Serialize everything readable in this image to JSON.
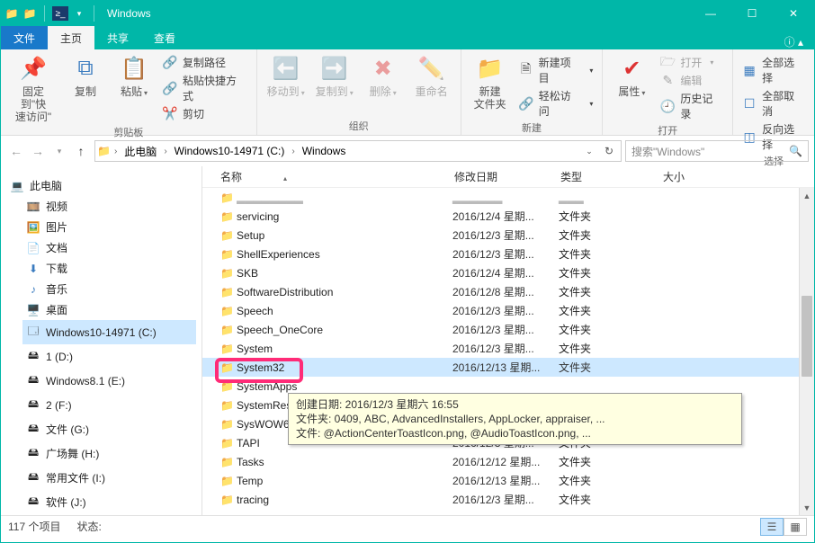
{
  "title": "Windows",
  "tabs": {
    "file": "文件",
    "home": "主页",
    "share": "共享",
    "view": "查看"
  },
  "ribbon": {
    "pin": "固定到\"快\n速访问\"",
    "copy": "复制",
    "paste": "粘贴",
    "copypath": "复制路径",
    "pastelnk": "粘贴快捷方式",
    "cut": "剪切",
    "g1": "剪贴板",
    "moveto": "移动到",
    "copyto": "复制到",
    "delete": "删除",
    "rename": "重命名",
    "g2": "组织",
    "newfolder": "新建\n文件夹",
    "newitem": "新建项目",
    "easyaccess": "轻松访问",
    "g3": "新建",
    "props": "属性",
    "open": "打开",
    "edit": "编辑",
    "history": "历史记录",
    "g4": "打开",
    "selectall": "全部选择",
    "selectnone": "全部取消",
    "invertsel": "反向选择",
    "g5": "选择"
  },
  "breadcrumb": {
    "a": "此电脑",
    "b": "Windows10-14971 (C:)",
    "c": "Windows"
  },
  "search_placeholder": "搜索\"Windows\"",
  "columns": {
    "name": "名称",
    "date": "修改日期",
    "type": "类型",
    "size": "大小"
  },
  "tree": {
    "pc": "此电脑",
    "videos": "视频",
    "pictures": "图片",
    "documents": "文档",
    "downloads": "下载",
    "music": "音乐",
    "desktop": "桌面",
    "cdrive": "Windows10-14971 (C:)",
    "d1": "1 (D:)",
    "d2": "Windows8.1 (E:)",
    "d3": "2 (F:)",
    "d4": "文件 (G:)",
    "d5": "广场舞 (H:)",
    "d6": "常用文件 (I:)",
    "d7": "软件 (J:)"
  },
  "rows": [
    {
      "name": "servicing",
      "date": "2016/12/4 星期...",
      "type": "文件夹"
    },
    {
      "name": "Setup",
      "date": "2016/12/3 星期...",
      "type": "文件夹"
    },
    {
      "name": "ShellExperiences",
      "date": "2016/12/3 星期...",
      "type": "文件夹"
    },
    {
      "name": "SKB",
      "date": "2016/12/4 星期...",
      "type": "文件夹"
    },
    {
      "name": "SoftwareDistribution",
      "date": "2016/12/8 星期...",
      "type": "文件夹"
    },
    {
      "name": "Speech",
      "date": "2016/12/3 星期...",
      "type": "文件夹"
    },
    {
      "name": "Speech_OneCore",
      "date": "2016/12/3 星期...",
      "type": "文件夹"
    },
    {
      "name": "System",
      "date": "2016/12/3 星期...",
      "type": "文件夹"
    },
    {
      "name": "System32",
      "date": "2016/12/13 星期...",
      "type": "文件夹",
      "sel": true
    },
    {
      "name": "SystemApps",
      "date": "",
      "type": ""
    },
    {
      "name": "SystemReso",
      "date": "",
      "type": ""
    },
    {
      "name": "SysWOW64",
      "date": "",
      "type": ""
    },
    {
      "name": "TAPI",
      "date": "2016/12/3 星期...",
      "type": "文件夹"
    },
    {
      "name": "Tasks",
      "date": "2016/12/12 星期...",
      "type": "文件夹"
    },
    {
      "name": "Temp",
      "date": "2016/12/13 星期...",
      "type": "文件夹"
    },
    {
      "name": "tracing",
      "date": "2016/12/3 星期...",
      "type": "文件夹"
    }
  ],
  "tooltip": {
    "l1": "创建日期: 2016/12/3 星期六 16:55",
    "l2": "文件夹: 0409, ABC, AdvancedInstallers, AppLocker, appraiser, ...",
    "l3": "文件: @ActionCenterToastIcon.png, @AudioToastIcon.png, ..."
  },
  "status": {
    "count": "117 个项目",
    "state": "状态:"
  }
}
